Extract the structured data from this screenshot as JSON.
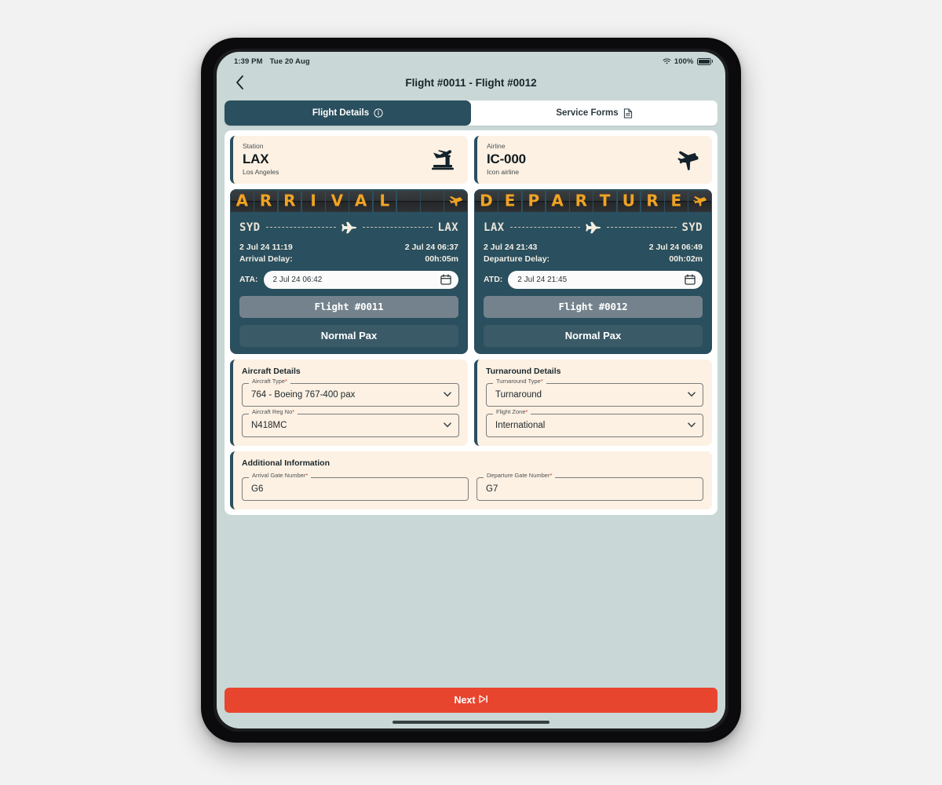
{
  "status_bar": {
    "time": "1:39 PM",
    "date": "Tue 20 Aug",
    "battery": "100%",
    "wifi_icon": "wifi-icon",
    "battery_icon": "battery-full-icon"
  },
  "nav": {
    "back_icon": "chevron-left-icon",
    "title": "Flight #0011 - Flight #0012"
  },
  "tabs": [
    {
      "label": "Flight Details",
      "icon": "info-circle-icon",
      "active": true
    },
    {
      "label": "Service Forms",
      "icon": "document-icon",
      "active": false
    }
  ],
  "info_cards": [
    {
      "label": "Station",
      "value": "LAX",
      "sub": "Los Angeles",
      "icon": "control-tower-icon"
    },
    {
      "label": "Airline",
      "value": "IC-000",
      "sub": "Icon airline",
      "icon": "airplane-icon"
    }
  ],
  "boards": [
    {
      "board_text": "ARRIVAL",
      "board_tiles": [
        "A",
        "R",
        "R",
        "I",
        "V",
        "A",
        "L",
        "",
        "",
        ""
      ],
      "board_end_icon": "airplane-arrival-icon",
      "origin": "SYD",
      "destination": "LAX",
      "plane_icon": "airplane-route-icon",
      "time_left": "2 Jul 24 11:19",
      "time_right": "2 Jul 24 06:37",
      "delay_label": "Arrival Delay:",
      "delay_value": "00h:05m",
      "actual_label": "ATA:",
      "actual_value": "2 Jul 24 06:42",
      "calendar_icon": "calendar-icon",
      "flight_button": "Flight #0011",
      "pax_button": "Normal Pax"
    },
    {
      "board_text": "DEPARTURE",
      "board_tiles": [
        "D",
        "E",
        "P",
        "A",
        "R",
        "T",
        "U",
        "R",
        "E",
        ""
      ],
      "board_end_icon": "airplane-departure-icon",
      "origin": "LAX",
      "destination": "SYD",
      "plane_icon": "airplane-route-icon",
      "time_left": "2 Jul 24 21:43",
      "time_right": "2 Jul 24 06:49",
      "delay_label": "Departure Delay:",
      "delay_value": "00h:02m",
      "actual_label": "ATD:",
      "actual_value": "2 Jul 24 21:45",
      "calendar_icon": "calendar-icon",
      "flight_button": "Flight #0012",
      "pax_button": "Normal Pax"
    }
  ],
  "aircraft_details": {
    "title": "Aircraft Details",
    "fields": [
      {
        "label": "Aircraft Type",
        "required": "*",
        "value": "764 - Boeing 767-400 pax",
        "icon": "chevron-down-icon"
      },
      {
        "label": "Aircraft Reg No",
        "required": "*",
        "value": "N418MC",
        "icon": "chevron-down-icon"
      }
    ]
  },
  "turnaround_details": {
    "title": "Turnaround Details",
    "fields": [
      {
        "label": "Turnaround Type",
        "required": "*",
        "value": "Turnaround",
        "icon": "chevron-down-icon"
      },
      {
        "label": "Flight Zone",
        "required": "*",
        "value": "International",
        "icon": "chevron-down-icon"
      }
    ]
  },
  "additional_information": {
    "title": "Additional Information",
    "fields": [
      {
        "label": "Arrival Gate Number",
        "required": "*",
        "value": "G6"
      },
      {
        "label": "Departure Gate Number",
        "required": "*",
        "value": "G7"
      }
    ]
  },
  "footer": {
    "next_label": "Next",
    "next_icon": "skip-forward-icon"
  },
  "colors": {
    "teal": "#2a4f5e",
    "cream": "#fdf1e3",
    "screen_bg": "#c9d8d6",
    "accent_red": "#e8452f",
    "board_amber": "#f0a323",
    "flight_pill": "#73828c",
    "pax_pill": "#3a5a67",
    "required_red": "#d9342b"
  }
}
